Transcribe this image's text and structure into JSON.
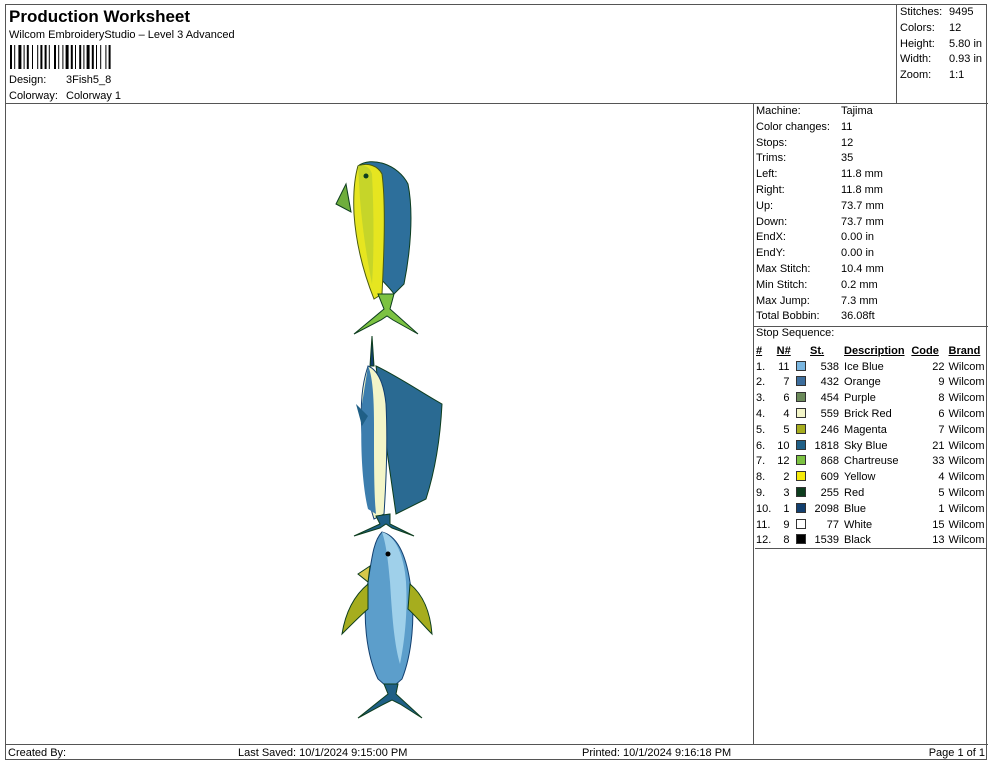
{
  "header": {
    "title": "Production Worksheet",
    "subtitle": "Wilcom EmbroideryStudio – Level 3 Advanced",
    "design_label": "Design:",
    "design_value": "3Fish5_8",
    "colorway_label": "Colorway:",
    "colorway_value": "Colorway 1"
  },
  "summary": [
    {
      "label": "Stitches:",
      "value": "9495"
    },
    {
      "label": "Colors:",
      "value": "12"
    },
    {
      "label": "Height:",
      "value": "5.80 in"
    },
    {
      "label": "Width:",
      "value": "0.93 in"
    },
    {
      "label": "Zoom:",
      "value": "1:1"
    }
  ],
  "specs": [
    {
      "label": "Machine:",
      "value": "Tajima"
    },
    {
      "label": "Color changes:",
      "value": "11"
    },
    {
      "label": "Stops:",
      "value": "12"
    },
    {
      "label": "Trims:",
      "value": "35"
    },
    {
      "label": "Left:",
      "value": "11.8 mm"
    },
    {
      "label": "Right:",
      "value": "11.8 mm"
    },
    {
      "label": "Up:",
      "value": "73.7 mm"
    },
    {
      "label": "Down:",
      "value": "73.7 mm"
    },
    {
      "label": "EndX:",
      "value": "0.00 in"
    },
    {
      "label": "EndY:",
      "value": "0.00 in"
    },
    {
      "label": "Max Stitch:",
      "value": "10.4 mm"
    },
    {
      "label": "Min Stitch:",
      "value": "0.2 mm"
    },
    {
      "label": "Max Jump:",
      "value": "7.3 mm"
    },
    {
      "label": "Total Bobbin:",
      "value": "36.08ft"
    }
  ],
  "stop_sequence": {
    "title": "Stop Sequence:",
    "headers": [
      "#",
      "N#",
      "St.",
      "Description",
      "Code",
      "Brand"
    ],
    "rows": [
      {
        "idx": "1.",
        "n": "11",
        "color": "#7ab6e0",
        "st": "538",
        "desc": "Ice Blue",
        "code": "22",
        "brand": "Wilcom"
      },
      {
        "idx": "2.",
        "n": "7",
        "color": "#3c6d9c",
        "st": "432",
        "desc": "Orange",
        "code": "9",
        "brand": "Wilcom"
      },
      {
        "idx": "3.",
        "n": "6",
        "color": "#6b8a5a",
        "st": "454",
        "desc": "Purple",
        "code": "8",
        "brand": "Wilcom"
      },
      {
        "idx": "4.",
        "n": "4",
        "color": "#f3f5c8",
        "st": "559",
        "desc": "Brick Red",
        "code": "6",
        "brand": "Wilcom"
      },
      {
        "idx": "5.",
        "n": "5",
        "color": "#a6ad1e",
        "st": "246",
        "desc": "Magenta",
        "code": "7",
        "brand": "Wilcom"
      },
      {
        "idx": "6.",
        "n": "10",
        "color": "#1f5f86",
        "st": "1818",
        "desc": "Sky Blue",
        "code": "21",
        "brand": "Wilcom"
      },
      {
        "idx": "7.",
        "n": "12",
        "color": "#7cc242",
        "st": "868",
        "desc": "Chartreuse",
        "code": "33",
        "brand": "Wilcom"
      },
      {
        "idx": "8.",
        "n": "2",
        "color": "#f5ea0a",
        "st": "609",
        "desc": "Yellow",
        "code": "4",
        "brand": "Wilcom"
      },
      {
        "idx": "9.",
        "n": "3",
        "color": "#0d3d1e",
        "st": "255",
        "desc": "Red",
        "code": "5",
        "brand": "Wilcom"
      },
      {
        "idx": "10.",
        "n": "1",
        "color": "#123f6f",
        "st": "2098",
        "desc": "Blue",
        "code": "1",
        "brand": "Wilcom"
      },
      {
        "idx": "11.",
        "n": "9",
        "color": "#ffffff",
        "st": "77",
        "desc": "White",
        "code": "15",
        "brand": "Wilcom"
      },
      {
        "idx": "12.",
        "n": "8",
        "color": "#000000",
        "st": "1539",
        "desc": "Black",
        "code": "13",
        "brand": "Wilcom"
      }
    ]
  },
  "footer": {
    "created": "Created By:",
    "saved": "Last Saved: 10/1/2024 9:15:00 PM",
    "printed": "Printed: 10/1/2024 9:16:18 PM",
    "page": "Page 1 of 1"
  }
}
